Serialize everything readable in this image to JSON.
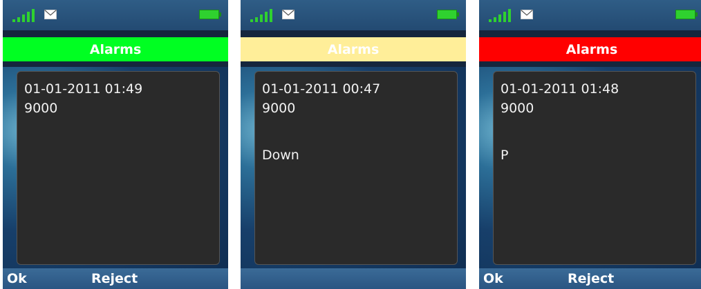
{
  "screens": [
    {
      "header": {
        "title": "Alarms",
        "color": "#00ff22"
      },
      "message": {
        "datetime": "01-01-2011 01:49",
        "number": "9000",
        "text": ""
      },
      "softkeys": {
        "left": "Ok",
        "center": "Reject"
      }
    },
    {
      "header": {
        "title": "Alarms",
        "color": "#ffee99"
      },
      "message": {
        "datetime": "01-01-2011 00:47",
        "number": "9000",
        "text": "Down"
      },
      "softkeys": {
        "left": "",
        "center": ""
      }
    },
    {
      "header": {
        "title": "Alarms",
        "color": "#ff0000"
      },
      "message": {
        "datetime": "01-01-2011 01:48",
        "number": "9000",
        "text": "P"
      },
      "softkeys": {
        "left": "Ok",
        "center": "Reject"
      }
    }
  ],
  "status_icons": [
    "signal-icon",
    "envelope-icon",
    "battery-icon"
  ]
}
